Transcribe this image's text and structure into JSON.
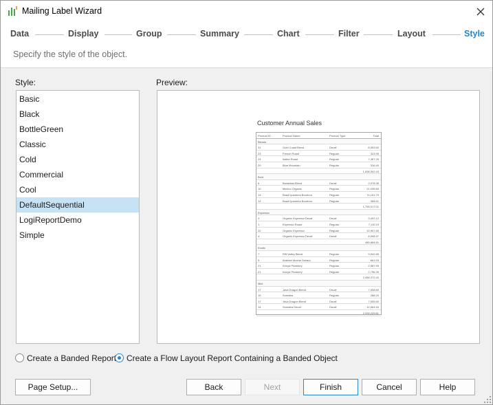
{
  "window": {
    "title": "Mailing Label Wizard"
  },
  "steps": [
    {
      "label": "Data",
      "active": false
    },
    {
      "label": "Display",
      "active": false
    },
    {
      "label": "Group",
      "active": false
    },
    {
      "label": "Summary",
      "active": false
    },
    {
      "label": "Chart",
      "active": false
    },
    {
      "label": "Filter",
      "active": false
    },
    {
      "label": "Layout",
      "active": false
    },
    {
      "label": "Style",
      "active": true
    }
  ],
  "subtitle": "Specify the style of the object.",
  "style_panel": {
    "label": "Style:",
    "items": [
      "Basic",
      "Black",
      "BottleGreen",
      "Classic",
      "Cold",
      "Commercial",
      "Cool",
      "DefaultSequential",
      "LogiReportDemo",
      "Simple"
    ],
    "selected": "DefaultSequential"
  },
  "preview_panel": {
    "label": "Preview:",
    "report": {
      "title": "Customer Annual Sales",
      "columns": [
        "Product ID",
        "Product Name",
        "Product Type",
        "Total"
      ],
      "rows": [
        {
          "kind": "group",
          "cells": [
            "Blends"
          ]
        },
        {
          "kind": "data",
          "cells": [
            "31",
            "Gold Coast Blend",
            "Decaf",
            "8,553.60"
          ]
        },
        {
          "kind": "data",
          "cells": [
            "23",
            "French Roast",
            "Regular",
            "323.95"
          ]
        },
        {
          "kind": "data",
          "cells": [
            "24",
            "Italian Roast",
            "Regular",
            "7,367.25"
          ]
        },
        {
          "kind": "data",
          "cells": [
            "29",
            "Blue Mountain",
            "Regular",
            "316.40"
          ]
        },
        {
          "kind": "total",
          "cells": [
            "1,838,502.43"
          ]
        },
        {
          "kind": "group",
          "cells": [
            "Bold"
          ]
        },
        {
          "kind": "data",
          "cells": [
            "6",
            "Breakfast Blend",
            "Decaf",
            "2,078.36"
          ]
        },
        {
          "kind": "data",
          "cells": [
            "10",
            "Mexico Organic",
            "Regular",
            "21,035.60"
          ]
        },
        {
          "kind": "data",
          "cells": [
            "13",
            "Brazil Ipanema Bourbon",
            "Regular",
            "74,151.70"
          ]
        },
        {
          "kind": "data",
          "cells": [
            "13",
            "Brazil Ipanema Bourbon",
            "Regular",
            "384.61"
          ]
        },
        {
          "kind": "total",
          "cells": [
            "1,799,017.01"
          ]
        },
        {
          "kind": "group",
          "cells": [
            "Espresso"
          ]
        },
        {
          "kind": "data",
          "cells": [
            "4",
            "Organic Espresso Decaf",
            "Decaf",
            "3,402.12"
          ]
        },
        {
          "kind": "data",
          "cells": [
            "1",
            "Espresso Roast",
            "Regular",
            "7,110.19"
          ]
        },
        {
          "kind": "data",
          "cells": [
            "22",
            "Organic Espresso",
            "Regular",
            "10,907.65"
          ]
        },
        {
          "kind": "data",
          "cells": [
            "4",
            "Organic Espresso Decaf",
            "Decaf",
            "8,598.97"
          ]
        },
        {
          "kind": "total",
          "cells": [
            "480,684.61"
          ]
        },
        {
          "kind": "group",
          "cells": [
            "Exotic"
          ]
        },
        {
          "kind": "data",
          "cells": [
            "7",
            "Rift Valley Blend",
            "Regular",
            "9,542.85"
          ]
        },
        {
          "kind": "data",
          "cells": [
            "5",
            "Arabian Mocha Sanani",
            "Regular",
            "661.03"
          ]
        },
        {
          "kind": "data",
          "cells": [
            "21",
            "Kenya Peaberry",
            "Regular",
            "2,587.95"
          ]
        },
        {
          "kind": "data",
          "cells": [
            "21",
            "Kenya Peaberry",
            "Regular",
            "2,796.39"
          ]
        },
        {
          "kind": "total",
          "cells": [
            "2,096,372.40"
          ]
        },
        {
          "kind": "group",
          "cells": [
            "Mild"
          ]
        },
        {
          "kind": "data",
          "cells": [
            "17",
            "Java Dragon Blend",
            "Decaf",
            "7,508.60"
          ]
        },
        {
          "kind": "data",
          "cells": [
            "15",
            "Sumatra",
            "Regular",
            "288.20"
          ]
        },
        {
          "kind": "data",
          "cells": [
            "17",
            "Java Dragon Blend",
            "Decaf",
            "7,505.60"
          ]
        },
        {
          "kind": "data",
          "cells": [
            "14",
            "Sumatra Decaf",
            "Decaf",
            "12,664.94"
          ]
        },
        {
          "kind": "total",
          "cells": [
            "2,334,229.81"
          ]
        }
      ]
    }
  },
  "report_options": [
    {
      "label": "Create a Banded Report",
      "checked": false
    },
    {
      "label": "Create a Flow Layout Report Containing a Banded Object",
      "checked": true
    }
  ],
  "buttons": {
    "page_setup": "Page Setup...",
    "back": "Back",
    "next": "Next",
    "finish": "Finish",
    "cancel": "Cancel",
    "help": "Help"
  },
  "colors": {
    "accent": "#2a86c9",
    "selection": "#c7e2f5",
    "icon_green": "#4ea34a"
  },
  "icons": {
    "app": "wizard-bars-icon",
    "close": "close-icon",
    "grip": "resize-grip-icon"
  }
}
